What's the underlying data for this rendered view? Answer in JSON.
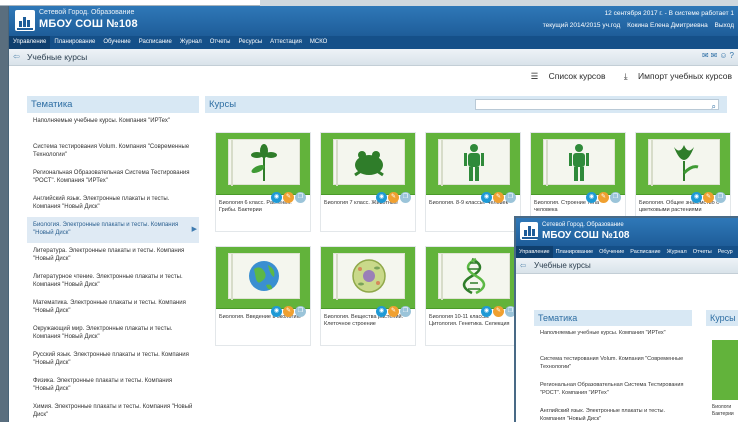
{
  "header": {
    "subtitle": "Сетевой Город. Образование",
    "school": "МБОУ СОШ №108",
    "date": "12 сентября 2017 г. - В системе работает 1",
    "year": "текущий 2014/2015 уч.год",
    "user": "Кокина Елена Дмитриевна",
    "logout": "Выход"
  },
  "nav": [
    "Управление",
    "Планирование",
    "Обучение",
    "Расписание",
    "Журнал",
    "Отчеты",
    "Ресурсы",
    "Аттестация",
    "МСКО"
  ],
  "page_title": "Учебные курсы",
  "actions": {
    "list": "Список курсов",
    "import": "Импорт учебных курсов"
  },
  "topics": {
    "heading": "Тематика",
    "items": [
      "Наполняемые учебные курсы. Компания \"ИРТех\"",
      "Система тестирования Volum. Компания \"Современные Технологии\"",
      "Региональная Образовательная Система Тестирования \"РОСТ\". Компания \"ИРТех\"",
      "Английский язык. Электронные плакаты и тесты. Компания \"Новый Диск\"",
      "Биология. Электронные плакаты и тесты. Компания \"Новый Диск\"",
      "Литература. Электронные плакаты и тесты. Компания \"Новый Диск\"",
      "Литературное чтение. Электронные плакаты и тесты. Компания \"Новый Диск\"",
      "Математика. Электронные плакаты и тесты. Компания \"Новый Диск\"",
      "Окружающий мир. Электронные плакаты и тесты. Компания \"Новый Диск\"",
      "Русский язык. Электронные плакаты и тесты. Компания \"Новый Диск\"",
      "Физика. Электронные плакаты и тесты. Компания \"Новый Диск\"",
      "Химия. Электронные плакаты и тесты. Компания \"Новый Диск\""
    ]
  },
  "courses": {
    "heading": "Курсы",
    "items": [
      {
        "caption": "Биология 6 класс. Растения. Грибы. Бактерии",
        "icon": "flower-icon"
      },
      {
        "caption": "Биология 7 класс. Животные",
        "icon": "frog-icon"
      },
      {
        "caption": "Биология. 8-9 классы. Человек",
        "icon": "human-figure-icon"
      },
      {
        "caption": "Биология. Строение тела человека",
        "icon": "human-figure-icon"
      },
      {
        "caption": "Биология. Общее знакомство с цветковыми растениями",
        "icon": "tulip-icon"
      },
      {
        "caption": "Биология. Введение в экологию",
        "icon": "globe-icon"
      },
      {
        "caption": "Биология. Вещества растений. Клеточное строение",
        "icon": "cell-icon"
      },
      {
        "caption": "Биология 10-11 классы. Цитология. Генетика. Селекция",
        "icon": "dna-icon"
      }
    ]
  },
  "overlay": {
    "subtitle": "Сетевой Город. Образование",
    "school": "МБОУ СОШ №108",
    "nav": [
      "Управление",
      "Планирование",
      "Обучение",
      "Расписание",
      "Журнал",
      "Отчеты",
      "Ресур"
    ],
    "page_title": "Учебные курсы",
    "topics_heading": "Тематика",
    "courses_heading": "Курсы",
    "topics": [
      "Наполняемые учебные курсы. Компания \"ИРТех\"",
      "Система тестирования Volum. Компания \"Современные Технологии\"",
      "Региональная Образовательная Система Тестирования \"РОСТ\". Компания \"ИРТех\"",
      "Английский язык. Электронные плакаты и тесты. Компания \"Новый Диск\""
    ],
    "mini_caption_1": "Биологи",
    "mini_caption_2": "Бактерии"
  }
}
